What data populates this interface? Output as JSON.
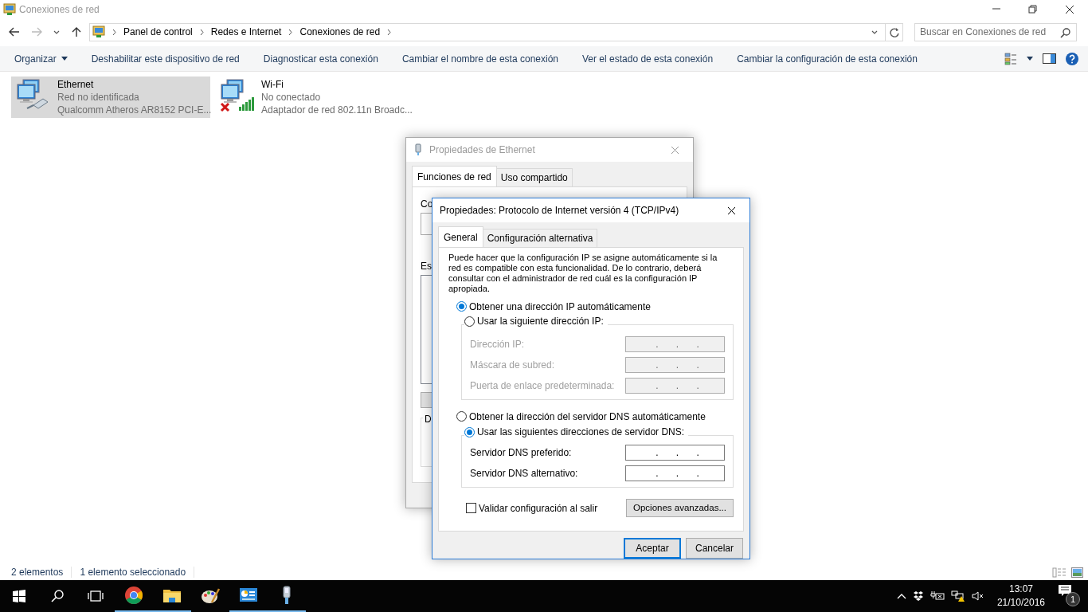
{
  "window": {
    "title": "Conexiones de red"
  },
  "address": {
    "breadcrumb": [
      "Panel de control",
      "Redes e Internet",
      "Conexiones de red"
    ],
    "search": {
      "placeholder": "Buscar en Conexiones de red"
    }
  },
  "toolbar": {
    "items": [
      {
        "label": "Organizar",
        "kind": "menu"
      },
      {
        "label": "Deshabilitar este dispositivo de red",
        "kind": "action"
      },
      {
        "label": "Diagnosticar esta conexión",
        "kind": "action"
      },
      {
        "label": "Cambiar el nombre de esta conexión",
        "kind": "action"
      },
      {
        "label": "Ver el estado de esta conexión",
        "kind": "action"
      },
      {
        "label": "Cambiar la configuración de esta conexión",
        "kind": "action"
      }
    ]
  },
  "connections": [
    {
      "name": "Ethernet",
      "status": "Red no identificada",
      "adapter": "Qualcomm Atheros AR8152 PCI-E...",
      "selected": true,
      "kind": "ethernet"
    },
    {
      "name": "Wi-Fi",
      "status": "No conectado",
      "adapter": "Adaptador de red 802.11n Broadc...",
      "selected": false,
      "kind": "wifi"
    }
  ],
  "status_bar": {
    "count": "2 elementos",
    "selection": "1 elemento seleccionado"
  },
  "ethernet_dialog": {
    "title": "Propiedades de Ethernet",
    "tabs": [
      {
        "label": "Funciones de red",
        "selected": true
      },
      {
        "label": "Uso compartido",
        "selected": false
      }
    ],
    "labels": [
      "Co",
      "Es",
      "D"
    ]
  },
  "ipv4_dialog": {
    "title": "Propiedades: Protocolo de Internet versión 4 (TCP/IPv4)",
    "tabs": [
      {
        "label": "General",
        "selected": true
      },
      {
        "label": "Configuración alternativa",
        "selected": false
      }
    ],
    "description": "Puede hacer que la configuración IP se asigne automáticamente si la red es compatible con esta funcionalidad. De lo contrario, deberá consultar con el administrador de red cuál es la configuración IP apropiada.",
    "ip_options": [
      {
        "label": "Obtener una dirección IP automáticamente",
        "selected": true
      },
      {
        "label": "Usar la siguiente dirección IP:",
        "selected": false
      }
    ],
    "ip_fields": [
      {
        "label": "Dirección IP:",
        "disabled": true,
        "separators": [
          ".",
          ".",
          "."
        ]
      },
      {
        "label": "Máscara de subred:",
        "disabled": true,
        "separators": [
          ".",
          ".",
          "."
        ]
      },
      {
        "label": "Puerta de enlace predeterminada:",
        "disabled": true,
        "separators": [
          ".",
          ".",
          "."
        ]
      }
    ],
    "dns_options": [
      {
        "label": "Obtener la dirección del servidor DNS automáticamente",
        "selected": false
      },
      {
        "label": "Usar las siguientes direcciones de servidor DNS:",
        "selected": true
      }
    ],
    "dns_fields": [
      {
        "label": "Servidor DNS preferido:",
        "disabled": false,
        "separators": [
          ".",
          ".",
          "."
        ]
      },
      {
        "label": "Servidor DNS alternativo:",
        "disabled": false,
        "separators": [
          ".",
          ".",
          "."
        ]
      }
    ],
    "validate": {
      "label": "Validar configuración al salir",
      "checked": false
    },
    "advanced_button": "Opciones avanzadas...",
    "buttons": [
      {
        "label": "Aceptar",
        "default": true
      },
      {
        "label": "Cancelar",
        "default": false
      }
    ]
  },
  "taskbar": {
    "apps": [
      {
        "kind": "chrome",
        "running": true
      },
      {
        "kind": "explorer",
        "running": true
      },
      {
        "kind": "paint",
        "running": false
      },
      {
        "kind": "control",
        "running": true
      },
      {
        "kind": "network",
        "running": true
      }
    ],
    "time": "13:07",
    "date": "21/10/2016",
    "notifications": "1"
  }
}
